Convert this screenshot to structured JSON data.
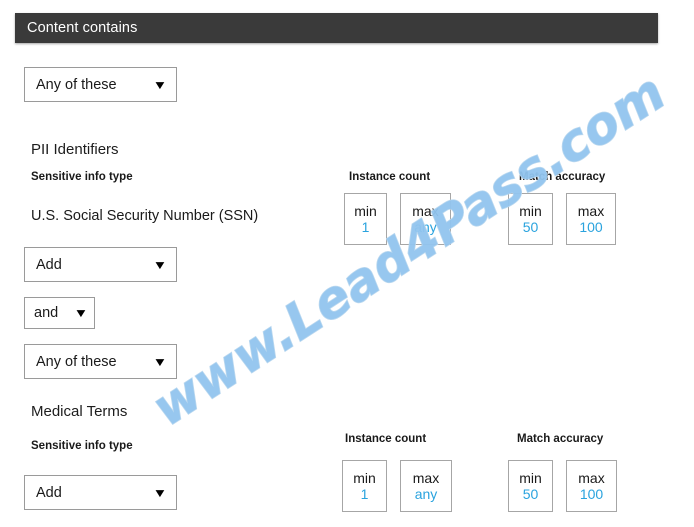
{
  "header": {
    "title": "Content contains"
  },
  "condition_selector_top": {
    "label": "Any of these",
    "caret": "chevron-down-icon"
  },
  "groups": [
    {
      "name": "PII Identifiers",
      "sensitive_info_type_label": "Sensitive info type",
      "sensitive_info_type_value": "U.S. Social Security Number (SSN)",
      "add_label": "Add",
      "instance_count": {
        "header": "Instance count",
        "min_label": "min",
        "min_value": "1",
        "max_label": "max",
        "max_value": "any"
      },
      "match_accuracy": {
        "header": "Match accuracy",
        "min_label": "min",
        "min_value": "50",
        "max_label": "max",
        "max_value": "100"
      }
    },
    {
      "name": "Medical Terms",
      "sensitive_info_type_label": "Sensitive info type",
      "sensitive_info_type_value": "",
      "add_label": "Add",
      "instance_count": {
        "header": "Instance count",
        "min_label": "min",
        "min_value": "1",
        "max_label": "max",
        "max_value": "any"
      },
      "match_accuracy": {
        "header": "Match accuracy",
        "min_label": "min",
        "min_value": "50",
        "max_label": "max",
        "max_value": "100"
      }
    }
  ],
  "operator_selector": {
    "label": "and",
    "caret": "chevron-down-icon"
  },
  "condition_selector_second": {
    "label": "Any of these",
    "caret": "chevron-down-icon"
  },
  "watermark": {
    "text": "www.Lead4Pass.com"
  },
  "colors": {
    "header_bar": "#3a3a3a",
    "value_blue": "#2aa3de",
    "watermark_blue": "#92c5ef",
    "box_border": "#a6a6a6"
  },
  "icons": {
    "caret": "▼"
  }
}
